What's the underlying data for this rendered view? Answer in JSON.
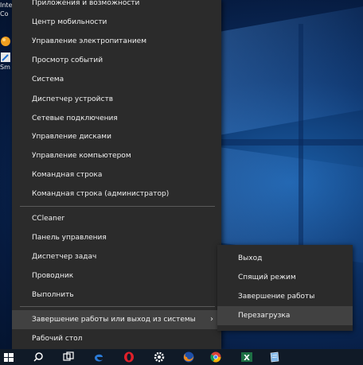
{
  "desktop": {
    "icons": [
      {
        "label_lines": [
          "Inte",
          "Co"
        ]
      },
      {
        "label_lines": [
          "Sm"
        ]
      }
    ]
  },
  "winx_menu": {
    "items": [
      "Приложения и возможности",
      "Центр мобильности",
      "Управление электропитанием",
      "Просмотр событий",
      "Система",
      "Диспетчер устройств",
      "Сетевые подключения",
      "Управление дисками",
      "Управление компьютером",
      "Командная строка",
      "Командная строка (администратор)",
      "CCleaner",
      "Панель управления",
      "Диспетчер задач",
      "Проводник",
      "Выполнить",
      "Завершение работы или выход из системы",
      "Рабочий стол"
    ],
    "submenu_arrow": "›"
  },
  "shutdown_submenu": {
    "items": [
      "Выход",
      "Спящий режим",
      "Завершение работы",
      "Перезагрузка"
    ],
    "highlighted": "Перезагрузка"
  },
  "taskbar": {
    "icons": [
      "windows-start-icon",
      "search-icon",
      "task-view-icon",
      "edge-icon",
      "opera-icon",
      "settings-gear-icon",
      "firefox-icon",
      "chrome-icon",
      "app-icon",
      "excel-icon",
      "notepad-icon"
    ],
    "excel_letter": "X"
  },
  "colors": {
    "menu_background": "#2b2b2b",
    "menu_hover": "#414141",
    "menu_text": "#f0f0f0",
    "separator": "#5a5a5a",
    "taskbar": "#101a27",
    "desktop_blue": "#1b5fa8"
  }
}
